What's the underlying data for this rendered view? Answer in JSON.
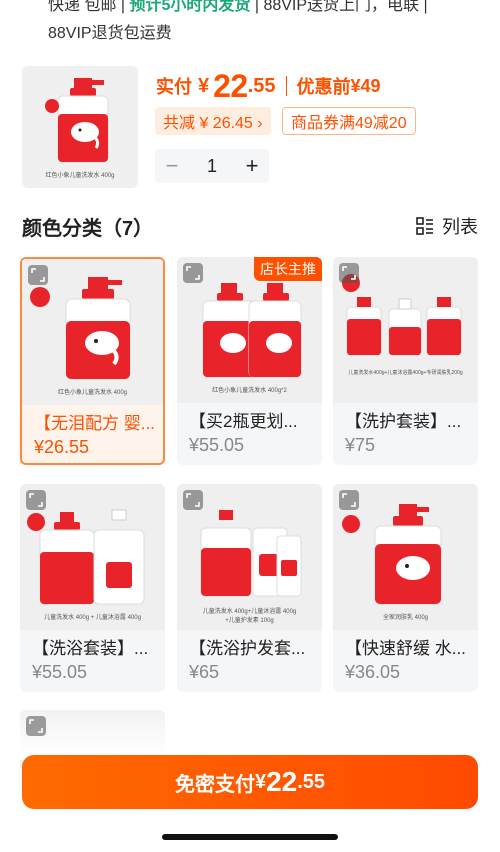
{
  "top": {
    "line1_a": "快递 包邮 | ",
    "line1_green": "预计5小时内发货",
    "line1_b": " | 88VIP送货上门，电联 |",
    "line2": "88VIP退货包运费"
  },
  "product": {
    "thumb_caption": "红色小象儿童洗发水 400g",
    "pay_label": "实付",
    "currency": "¥",
    "price_int": "22",
    "price_dec": ".55",
    "before_label": "优惠前",
    "before_price": "¥49",
    "save_tag": "共减 ¥ 26.45 ›",
    "coupon_tag": "商品券满49减20",
    "quantity": "1",
    "minus": "−",
    "plus": "+"
  },
  "section": {
    "title": "颜色分类（7）",
    "list_label": "列表"
  },
  "cards": [
    {
      "title": "【无泪配方 婴...",
      "price": "¥26.55",
      "caption": "红色小象儿童洗发水 400g",
      "selected": true
    },
    {
      "title": "【买2瓶更划...",
      "price": "¥55.05",
      "caption": "红色小象儿童洗发水 400g*2",
      "badge": "店长主推"
    },
    {
      "title": "【洗护套装】...",
      "price": "¥75",
      "caption": "儿童洗发水400g+儿童沐浴露400g+专研润肤乳200g"
    },
    {
      "title": "【洗浴套装】...",
      "price": "¥55.05",
      "caption": "儿童洗发水 400g + 儿童沐浴露 400g"
    },
    {
      "title": "【洗浴护发套...",
      "price": "¥65",
      "caption": "儿童洗发水 400g+儿童沐浴露 400g",
      "caption2": "+儿童护发素 100g"
    },
    {
      "title": "【快速舒缓 水...",
      "price": "¥36.05",
      "caption": "全家润肤乳 400g"
    }
  ],
  "pay_button": {
    "text": "免密支付",
    "currency": "¥",
    "int": "22",
    "dec": ".55"
  },
  "colors": {
    "accent": "#ff5000",
    "green": "#1ba873",
    "bottle_red": "#e8242a"
  }
}
